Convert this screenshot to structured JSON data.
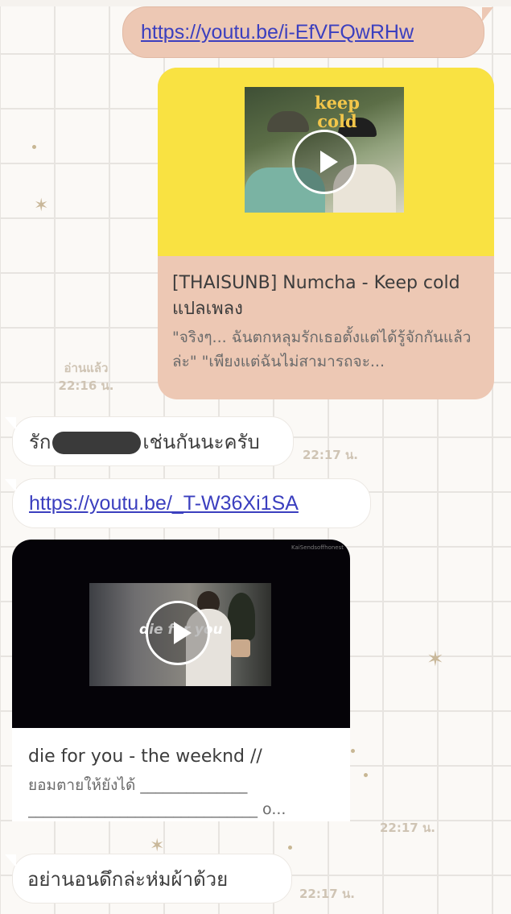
{
  "messages": {
    "out_link": {
      "url": "https://youtu.be/i-EfVFQwRHw"
    },
    "out_card": {
      "thumb_title": "keep cold",
      "title": "[THAISUNB] Numcha - Keep cold แปลเพลง",
      "description": "\"จริงๆ... ฉันตกหลุมรักเธอตั้งแต่ได้รู้จักกันแล้วล่ะ\" \"เพียงแต่ฉันไม่สามารถจะ...",
      "read_label": "อ่านแล้ว",
      "time": "22:16 น."
    },
    "in_text1": {
      "before": "รัก",
      "after": "เช่นกันนะครับ",
      "time": "22:17 น."
    },
    "in_link": {
      "url": "https://youtu.be/_T-W36Xi1SA"
    },
    "in_card": {
      "thumb_lyric": "die for you",
      "channel": "KaiSendsoffhonest",
      "title": "die for you - the weeknd //",
      "description": "ยอมตายให้ยังได้ ______________ ______________________________ o...",
      "time": "22:17 น."
    },
    "in_text2": {
      "text": "อย่านอนดึกล่ะห่มผ้าด้วย",
      "time": "22:17 น."
    }
  },
  "icons": [
    "play-icon",
    "star-icon"
  ],
  "colors": {
    "outgoing_bubble": "#edc8b4",
    "incoming_bubble": "#ffffff",
    "link": "#3b3fbf",
    "card_media_yellow": "#f9e242"
  }
}
